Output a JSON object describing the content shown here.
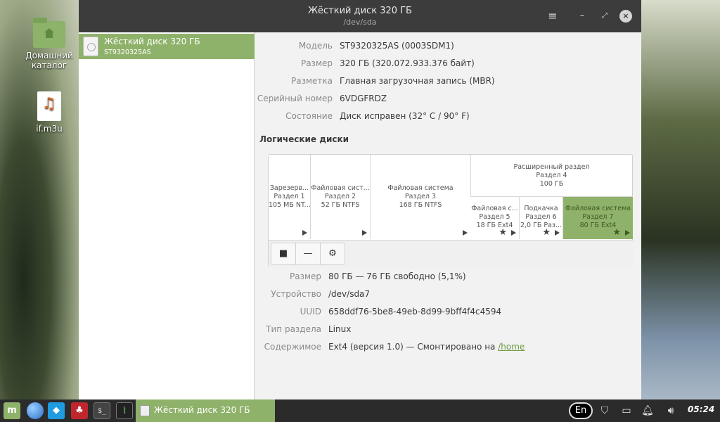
{
  "desktop": {
    "icons": [
      {
        "label": "Домашний каталог",
        "icon": "home-folder-icon"
      },
      {
        "label": "if.m3u",
        "icon": "playlist-file-icon"
      }
    ]
  },
  "window": {
    "title": "Жёсткий диск 320 ГБ",
    "subtitle": "/dev/sda",
    "controls": {
      "menu": "≡",
      "minimize": "–",
      "maximize": "⤢",
      "close": "×"
    }
  },
  "sidebar": {
    "items": [
      {
        "title": "Жёсткий диск 320 ГБ",
        "subtitle": "ST9320325AS",
        "icon": "hard-disk-icon",
        "selected": true
      }
    ]
  },
  "disk_info": {
    "rows": [
      {
        "label": "Модель",
        "value": "ST9320325AS (0003SDM1)"
      },
      {
        "label": "Размер",
        "value": "320 ГБ (320.072.933.376 байт)"
      },
      {
        "label": "Разметка",
        "value": "Главная загрузочная запись (MBR)"
      },
      {
        "label": "Серийный номер",
        "value": "6VDGFRDZ"
      },
      {
        "label": "Состояние",
        "value": "Диск исправен (32° C / 90° F)"
      }
    ]
  },
  "volumes": {
    "title": "Логические диски",
    "partitions": [
      {
        "l1": "Зарезерв...",
        "l2": "Раздел 1",
        "l3": "105 МБ NT...",
        "selected": false
      },
      {
        "l1": "Файловая сист...",
        "l2": "Раздел 2",
        "l3": "52 ГБ NTFS",
        "selected": false
      },
      {
        "l1": "Файловая система",
        "l2": "Раздел 3",
        "l3": "168 ГБ NTFS",
        "selected": false
      },
      {
        "l1": "Файловая с...",
        "l2": "Раздел 5",
        "l3": "18 ГБ Ext4",
        "selected": false
      },
      {
        "l1": "Подкачка",
        "l2": "Раздел 6",
        "l3": "2,0 ГБ Раз...",
        "selected": false
      },
      {
        "l1": "Файловая система",
        "l2": "Раздел 7",
        "l3": "80 ГБ Ext4",
        "selected": true
      }
    ],
    "extended": {
      "l1": "Расширенный раздел",
      "l2": "Раздел 4",
      "l3": "100 ГБ"
    },
    "toolbar": {
      "stop": "■",
      "remove": "—",
      "settings": "⚙"
    }
  },
  "partition_info": {
    "rows": [
      {
        "label": "Размер",
        "value": "80 ГБ — 76 ГБ свободно (5,1%)"
      },
      {
        "label": "Устройство",
        "value": "/dev/sda7"
      },
      {
        "label": "UUID",
        "value": "658ddf76-5be8-49eb-8d99-9bff4f4c4594"
      },
      {
        "label": "Тип раздела",
        "value": "Linux"
      },
      {
        "label": "Содержимое",
        "value_prefix": "Ext4 (версия 1.0) — Смонтировано на ",
        "link": "/home"
      }
    ]
  },
  "taskbar": {
    "launchers": [
      "menu-icon",
      "browser-icon",
      "kodi-icon",
      "app-icon",
      "terminal-icon",
      "system-monitor-icon"
    ],
    "active_task": "Жёсткий диск 320 ГБ",
    "terminal_glyph": "$_",
    "language": "En",
    "clock": "05:24"
  },
  "colors": {
    "accent": "#8fb26a",
    "titlebar": "#3c3c3c",
    "taskbar": "#2b2b2b",
    "link": "#6e9a3f"
  }
}
